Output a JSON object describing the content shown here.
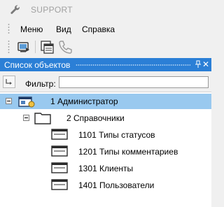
{
  "window": {
    "title": "SUPPORT"
  },
  "menu": {
    "items": [
      "Меню",
      "Вид",
      "Справка"
    ]
  },
  "toolbar": {
    "buttons": [
      "screen-icon",
      "windows-icon",
      "phone-icon"
    ]
  },
  "panel": {
    "title": "Список объектов",
    "pin_glyph": "ș",
    "close_glyph": "✕"
  },
  "filter": {
    "label": "Фильтр:",
    "value": ""
  },
  "tree": {
    "nodes": [
      {
        "label": "1 Администратор",
        "icon": "admin-folder-icon",
        "expanded": true,
        "selected": true
      },
      {
        "label": "2 Справочники",
        "icon": "folder-icon",
        "expanded": true,
        "selected": false
      },
      {
        "label": "1101 Типы статусов",
        "icon": "window-icon",
        "selected": false
      },
      {
        "label": "1201 Типы комментариев",
        "icon": "window-icon",
        "selected": false
      },
      {
        "label": "1301 Клиенты",
        "icon": "window-icon",
        "selected": false
      },
      {
        "label": "1401 Пользователи",
        "icon": "window-icon",
        "selected": false
      }
    ]
  },
  "colors": {
    "accent": "#2b7fd6",
    "selection": "#99c9ef",
    "title_text": "#a0a0a0"
  }
}
